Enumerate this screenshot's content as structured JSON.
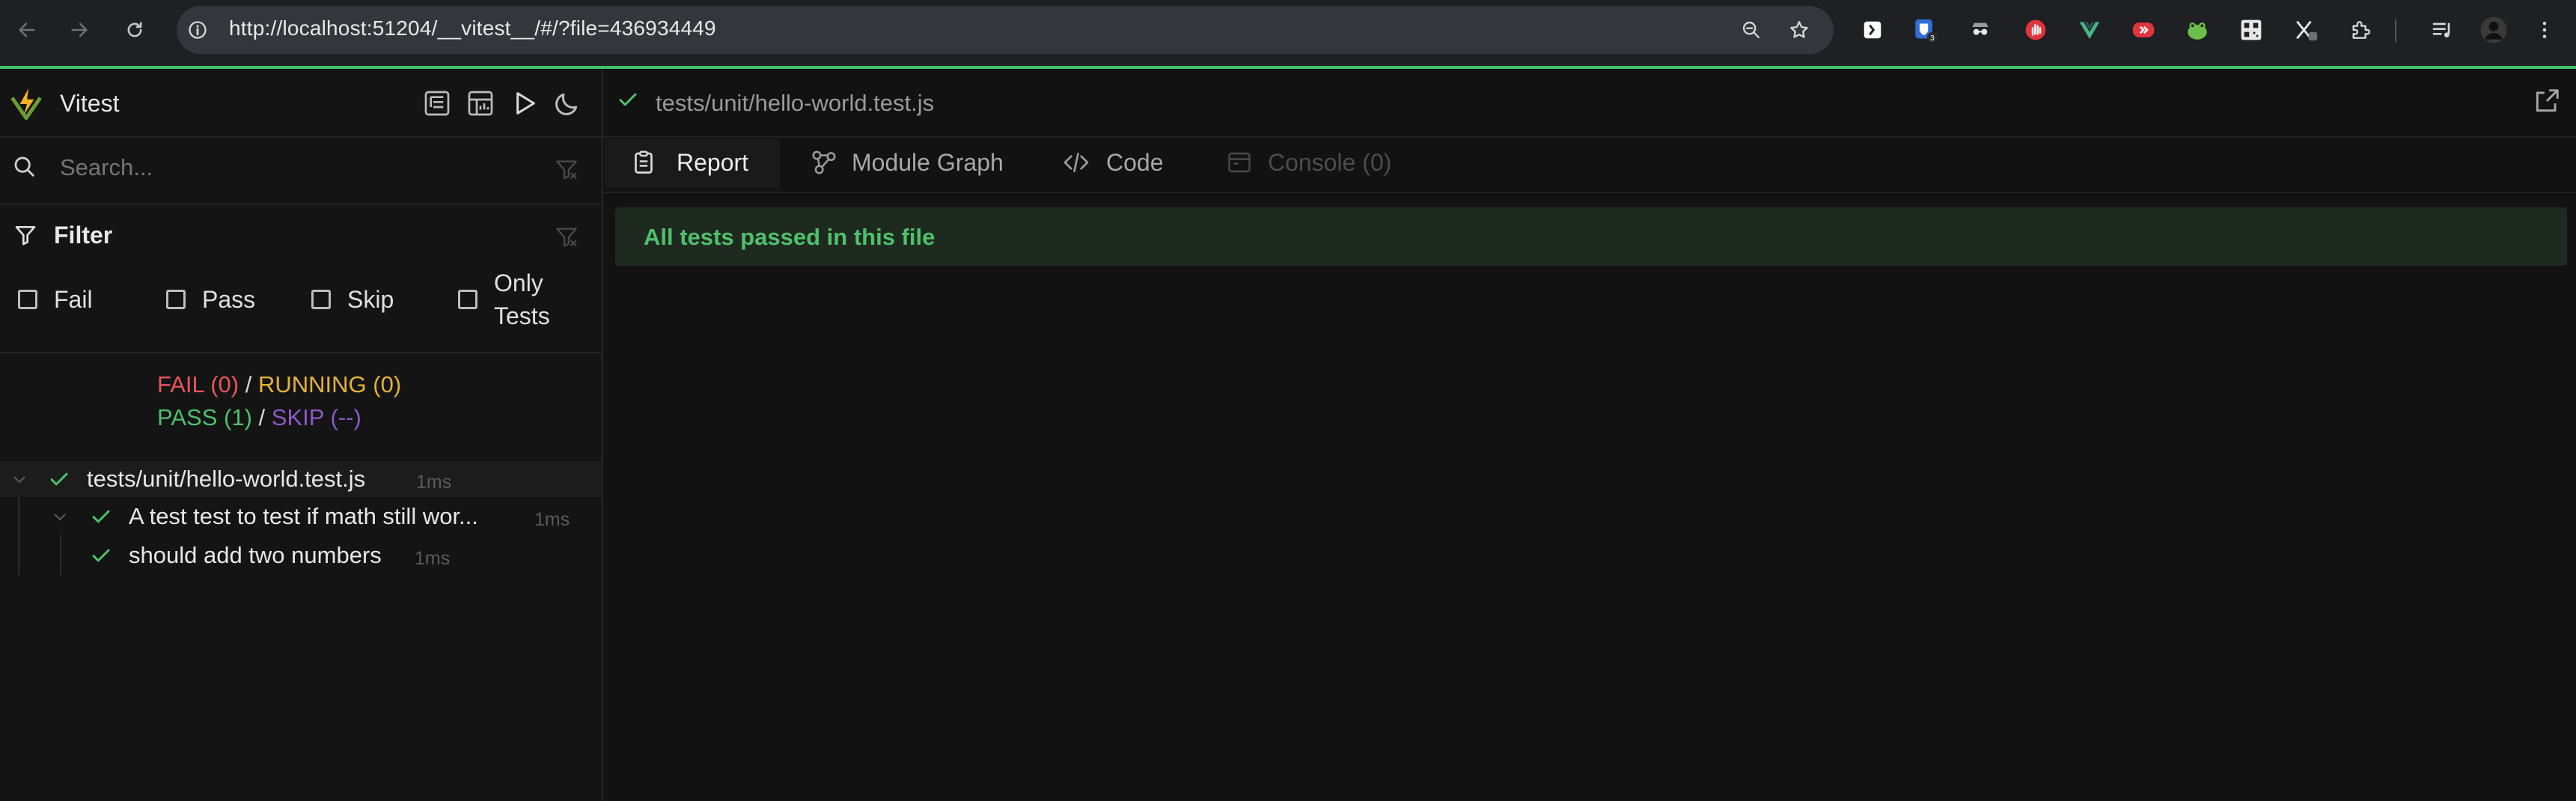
{
  "browser": {
    "url": "http://localhost:51204/__vitest__/#/?file=436934449",
    "extension_badge": "3",
    "icons": [
      "back-icon",
      "forward-icon",
      "reload-icon",
      "site-info-icon",
      "zoom-icon",
      "bookmark-star-icon",
      "extensions-icon",
      "media-control-icon",
      "profile-avatar",
      "more-menu-icon"
    ]
  },
  "sidebar": {
    "app_name": "Vitest",
    "search": {
      "placeholder": "Search...",
      "value": ""
    },
    "filter": {
      "title": "Filter",
      "options": [
        {
          "label": "Fail",
          "checked": false
        },
        {
          "label": "Pass",
          "checked": false
        },
        {
          "label": "Skip",
          "checked": false
        },
        {
          "label_line1": "Only",
          "label_line2": "Tests",
          "checked": false
        }
      ]
    },
    "summary": {
      "fail": "FAIL (0)",
      "running": "RUNNING (0)",
      "pass": "PASS (1)",
      "skip": "SKIP (--)",
      "separator": "/"
    },
    "tree": [
      {
        "name": "tests/unit/hello-world.test.js",
        "duration": "1ms",
        "status": "pass"
      },
      {
        "name": "A test test to test if math still wor...",
        "duration": "1ms",
        "status": "pass"
      },
      {
        "name": "should add two numbers",
        "duration": "1ms",
        "status": "pass"
      }
    ]
  },
  "main": {
    "file_path": "tests/unit/hello-world.test.js",
    "tabs": [
      {
        "label": "Report",
        "active": true
      },
      {
        "label": "Module Graph",
        "active": false
      },
      {
        "label": "Code",
        "active": false
      },
      {
        "label": "Console (0)",
        "active": false,
        "disabled": true
      }
    ],
    "banner": "All tests passed in this file"
  },
  "colors": {
    "pass": "#4fc16b",
    "fail": "#e6565b",
    "running": "#e4b23a",
    "skip": "#8a59c7",
    "accent": "#3ec16b",
    "background": "#121212"
  }
}
